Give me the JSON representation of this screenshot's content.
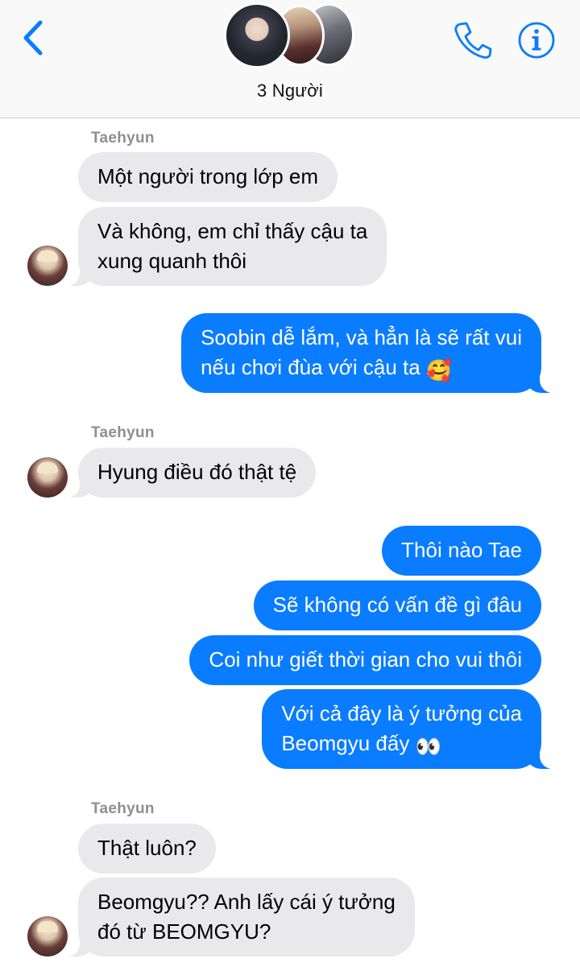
{
  "header": {
    "group_title": "3 Người",
    "back_icon": "chevron-left-icon",
    "call_icon": "phone-icon",
    "info_icon": "info-icon",
    "accent": "#0a7cff"
  },
  "messages": [
    {
      "sender": "Taehyun"
    },
    {
      "text": "Một người trong lớp em"
    },
    {
      "line1": "Và không, em chỉ thấy cậu ta",
      "line2": "xung quanh thôi"
    },
    {
      "line1": "Soobin dễ lắm, và hẳn là sẽ rất vui",
      "line2": "nếu chơi đùa với cậu ta",
      "emoji": "🥰"
    },
    {
      "sender": "Taehyun"
    },
    {
      "text": "Hyung điều đó thật tệ"
    },
    {
      "text": "Thôi nào Tae"
    },
    {
      "text": "Sẽ không có vấn đề gì đâu"
    },
    {
      "text": "Coi như giết thời gian cho vui thôi"
    },
    {
      "line1": "Với cả đây là ý tưởng của",
      "line2": "Beomgyu đấy",
      "emoji": "👀"
    },
    {
      "sender": "Taehyun"
    },
    {
      "text": "Thật luôn?"
    },
    {
      "line1": "Beomgyu?? Anh lấy cái ý tưởng",
      "line2": "đó từ BEOMGYU?"
    }
  ]
}
